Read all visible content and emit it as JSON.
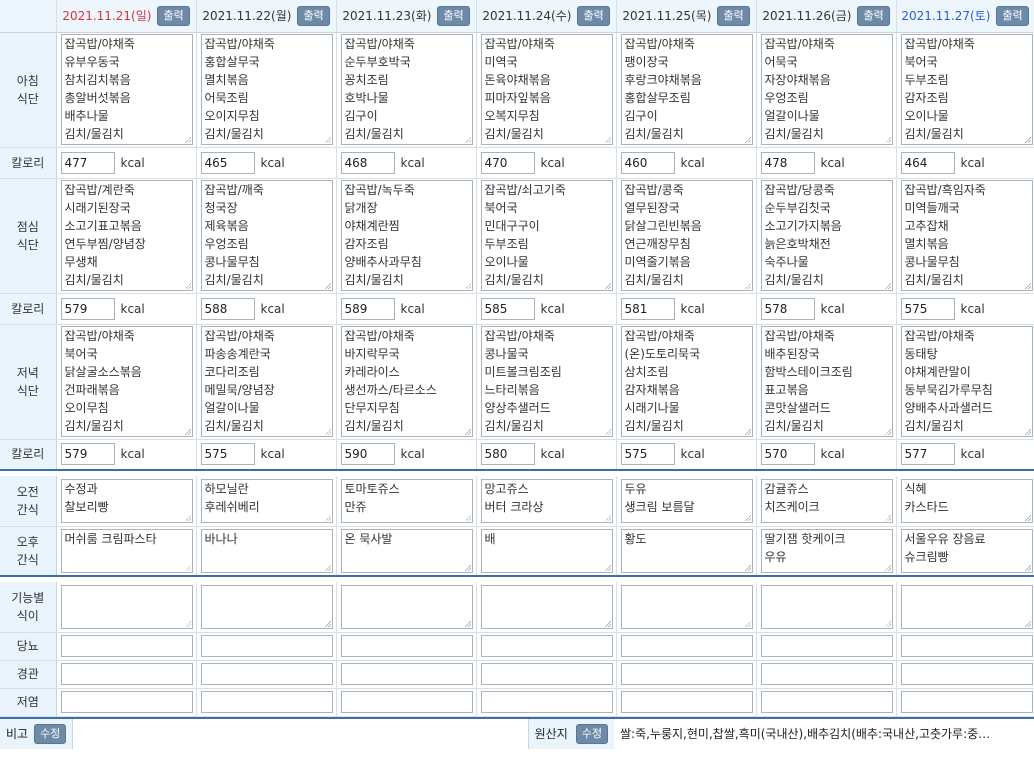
{
  "days": [
    {
      "date": "2021.11.21(일)",
      "type": "sun"
    },
    {
      "date": "2021.11.22(월)",
      "type": "norm"
    },
    {
      "date": "2021.11.23(화)",
      "type": "norm"
    },
    {
      "date": "2021.11.24(수)",
      "type": "norm"
    },
    {
      "date": "2021.11.25(목)",
      "type": "norm"
    },
    {
      "date": "2021.11.26(금)",
      "type": "norm"
    },
    {
      "date": "2021.11.27(토)",
      "type": "sat"
    }
  ],
  "print_label": "출력",
  "edit_label": "수정",
  "kcal_unit": "kcal",
  "row_labels": {
    "breakfast": "아침\n식단",
    "lunch": "점심\n식단",
    "dinner": "저녁\n식단",
    "calorie": "칼로리",
    "am_snack": "오전\n간식",
    "pm_snack": "오후\n간식",
    "functional": "기능별\n식이",
    "diabetes": "당뇨",
    "tube": "경관",
    "low_salt": "저염"
  },
  "breakfast": [
    "잡곡밥/야채죽\n유부우동국\n참치김치볶음\n총알버섯볶음\n배추나물\n김치/물김치",
    "잡곡밥/야채죽\n홍합살무국\n멸치볶음\n어묵조림\n오이지무침\n김치/물김치",
    "잡곡밥/야채죽\n순두부호박국\n꽁치조림\n호박나물\n김구이\n김치/물김치",
    "잡곡밥/야채죽\n미역국\n돈육야채볶음\n피마자잎볶음\n오복지무침\n김치/물김치",
    "잡곡밥/야채죽\n팽이장국\n후랑크야채볶음\n홍합살무조림\n김구이\n김치/물김치",
    "잡곡밥/야채죽\n어묵국\n자장야채볶음\n우엉조림\n얼갈이나물\n김치/물김치",
    "잡곡밥/야채죽\n북어국\n두부조림\n감자조림\n오이나물\n김치/물김치"
  ],
  "breakfast_kcal": [
    "477",
    "465",
    "468",
    "470",
    "460",
    "478",
    "464"
  ],
  "lunch": [
    "잡곡밥/계란죽\n시래기된장국\n소고기표고볶음\n연두부찜/양념장\n무생채\n김치/물김치",
    "잡곡밥/깨죽\n청국장\n제육볶음\n우엉조림\n콩나물무침\n김치/물김치",
    "잡곡밥/녹두죽\n닭개장\n야채계란찜\n감자조림\n양배추사과무침\n김치/물김치",
    "잡곡밥/쇠고기죽\n북어국\n민대구구이\n두부조림\n오이나물\n김치/물김치",
    "잡곡밥/콩죽\n열무된장국\n닭살그린빈볶음\n연근깨장무침\n미역줄기볶음\n김치/물김치",
    "잡곡밥/당콩죽\n순두부김칫국\n소고기가지볶음\n늙은호박채전\n숙주나물\n김치/물김치",
    "잡곡밥/흑임자죽\n미역들깨국\n고추잡채\n멸치볶음\n콩나물무침\n김치/물김치"
  ],
  "lunch_kcal": [
    "579",
    "588",
    "589",
    "585",
    "581",
    "578",
    "575"
  ],
  "dinner": [
    "잡곡밥/야채죽\n북어국\n닭살굴소스볶음\n건파래볶음\n오이무침\n김치/물김치",
    "잡곡밥/야채죽\n파송송계란국\n코다리조림\n메밀묵/양념장\n얼갈이나물\n김치/물김치",
    "잡곡밥/야채죽\n바지락무국\n카레라이스\n생선까스/타르소스\n단무지무침\n김치/물김치",
    "잡곡밥/야채죽\n콩나물국\n미트볼크림조림\n느타리볶음\n양상추샐러드\n김치/물김치",
    "잡곡밥/야채죽\n(온)도토리묵국\n삼치조림\n감자채볶음\n시래기나물\n김치/물김치",
    "잡곡밥/야채죽\n배추된장국\n함박스테이크조림\n표고볶음\n콘맛살샐러드\n김치/물김치",
    "잡곡밥/야채죽\n동태탕\n야채계란말이\n동부묵김가루무침\n양배추사과샐러드\n김치/물김치"
  ],
  "dinner_kcal": [
    "579",
    "575",
    "590",
    "580",
    "575",
    "570",
    "577"
  ],
  "am_snack": [
    "수정과\n찰보리빵",
    "하모닐란\n후레쉬베리",
    "토마토쥬스\n만쥬",
    "망고쥬스\n버터 크라상",
    "두유\n생크림 보름달",
    "감귤쥬스\n치즈케이크",
    "식혜\n카스타드"
  ],
  "pm_snack": [
    "머쉬룸 크림파스타",
    "바나나",
    "온 묵사발",
    "배",
    "황도",
    "딸기잼 핫케이크\n우유",
    "서울우유 장음료\n슈크림빵"
  ],
  "footer": {
    "note_label": "비고",
    "origin_label": "원산지",
    "origin_text": "쌀:죽,누룽지,현미,찹쌀,흑미(국내산),배추김치(배추:국내산,고춧가루:중…"
  }
}
